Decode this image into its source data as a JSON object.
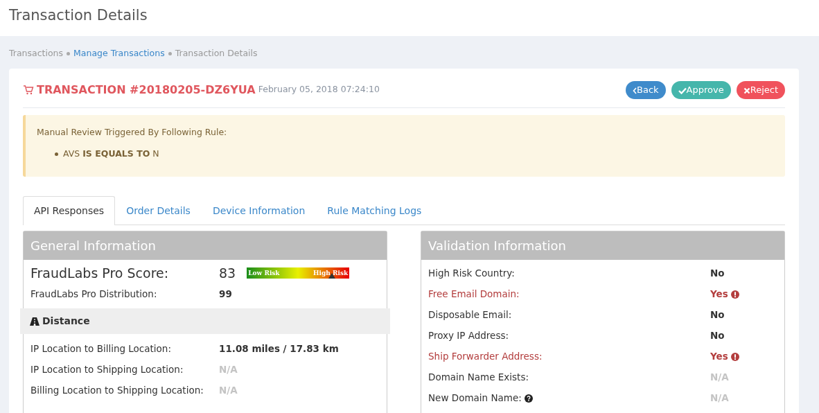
{
  "page_title": "Transaction Details",
  "breadcrumb": [
    {
      "label": "Transactions",
      "link": false
    },
    {
      "label": "Manage Transactions",
      "link": true
    },
    {
      "label": "Transaction Details",
      "link": false
    }
  ],
  "transaction": {
    "title": "TRANSACTION #20180205-DZ6YUA",
    "date": "February 05, 2018 07:24:10"
  },
  "buttons": [
    {
      "kind": "back",
      "label": "Back"
    },
    {
      "kind": "approve",
      "label": "Approve"
    },
    {
      "kind": "reject",
      "label": "Reject"
    }
  ],
  "alert": {
    "heading": "Manual Review Triggered By Following Rule:",
    "rules": [
      "AVS **IS EQUALS TO** N"
    ]
  },
  "tabs": [
    {
      "label": "API Responses",
      "selected": true
    },
    {
      "label": "Order Details",
      "selected": false
    },
    {
      "label": "Device Information",
      "selected": false
    },
    {
      "label": "Rule Matching Logs",
      "selected": false
    }
  ],
  "general": {
    "title": "General Information",
    "score": {
      "label": "FraudLabs Pro Score:",
      "value": "83",
      "level": 0.83,
      "low_label": "Low Risk",
      "high_label": "High Risk"
    },
    "rows": [
      {
        "label": "FraudLabs Pro Distribution:",
        "value": "99",
        "kind": "ok"
      }
    ],
    "section": {
      "title": "Distance",
      "rows": [
        {
          "label": "IP Location to Billing Location:",
          "value": "11.08 miles / 17.83 km",
          "kind": "ok"
        },
        {
          "label": "IP Location to Shipping Location:",
          "value": "N/A",
          "kind": "na"
        },
        {
          "label": "Billing Location to Shipping Location:",
          "value": "N/A",
          "kind": "na"
        }
      ]
    }
  },
  "validation": {
    "title": "Validation Information",
    "rows": [
      {
        "label": "High Risk Country:",
        "value": "No",
        "kind": "ok"
      },
      {
        "label": "Free Email Domain:",
        "value": "Yes",
        "kind": "risk"
      },
      {
        "label": "Disposable Email:",
        "value": "No",
        "kind": "ok"
      },
      {
        "label": "Proxy IP Address:",
        "value": "No",
        "kind": "ok"
      },
      {
        "label": "Ship Forwarder Address:",
        "value": "Yes",
        "kind": "risk"
      },
      {
        "label": "Domain Name Exists:",
        "value": "N/A",
        "kind": "na"
      },
      {
        "label": "New Domain Name:",
        "value": "N/A",
        "kind": "na",
        "help": true
      }
    ]
  }
}
